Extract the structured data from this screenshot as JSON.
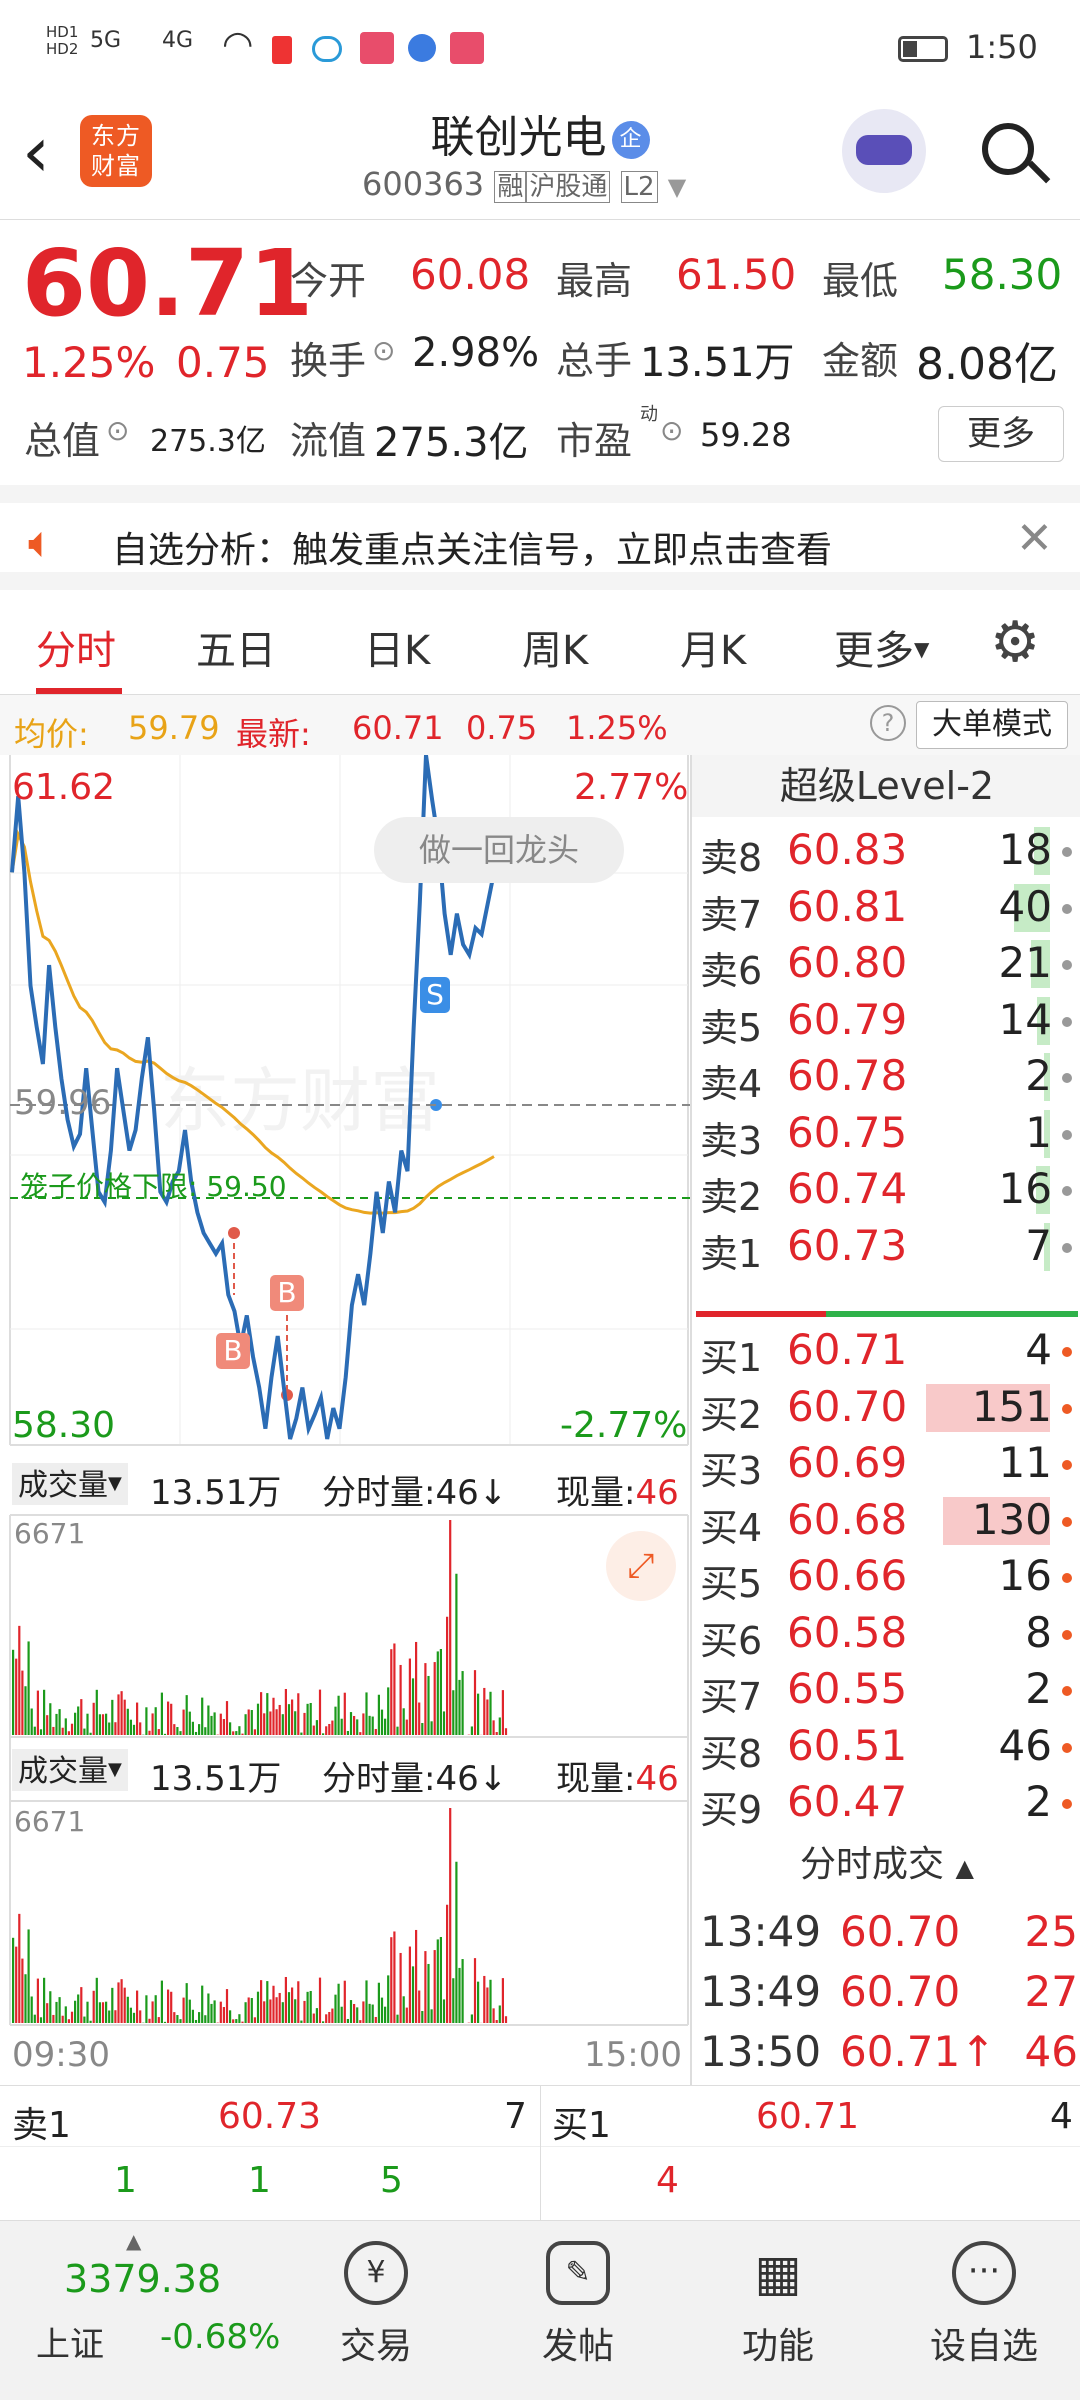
{
  "status": {
    "time": "1:50",
    "sig1": "5G",
    "sig2": "4G",
    "hd1": "HD1",
    "hd2": "HD2"
  },
  "header": {
    "logo": "东方财富",
    "title": "联创光电",
    "corp_badge": "企",
    "code": "600363",
    "tags": [
      "融",
      "沪股通",
      "L2"
    ]
  },
  "quote": {
    "price": "60.71",
    "pct": "1.25%",
    "chg": "0.75",
    "open_label": "今开",
    "open": "60.08",
    "high_label": "最高",
    "high": "61.50",
    "low_label": "最低",
    "low": "58.30",
    "turnover_label": "换手",
    "turnover": "2.98%",
    "vol_label": "总手",
    "vol": "13.51万",
    "amount_label": "金额",
    "amount": "8.08亿",
    "mktcap_label": "总值",
    "mktcap": "275.3亿",
    "float_label": "流值",
    "float": "275.3亿",
    "pe_label": "市盈",
    "pe_sup": "动",
    "pe": "59.28",
    "more": "更多"
  },
  "notice": {
    "text": "自选分析：触发重点关注信号，立即点击查看"
  },
  "tabs": [
    "分时",
    "五日",
    "日K",
    "周K",
    "月K",
    "更多"
  ],
  "infobar": {
    "avg_label": "均价:",
    "avg": "59.79",
    "last_label": "最新:",
    "last": "60.71",
    "chg": "0.75",
    "pct": "1.25%",
    "mode": "大单模式"
  },
  "chart": {
    "ymax": "61.62",
    "ymin": "58.30",
    "pct_up": "2.77%",
    "pct_down": "-2.77%",
    "prev_close": "59.96",
    "limit_label": "笼子价格下限:",
    "limit": "59.50",
    "bubble": "做一回龙头",
    "marker_s": "S",
    "marker_b": "B",
    "watermark": "东方财富",
    "vol_label": "成交量",
    "vol_total": "13.51万",
    "fs_label": "分时量:46↓",
    "now_label": "现量:",
    "now": "46",
    "vol_max": "6671",
    "t_start": "09:30",
    "t_end": "15:00",
    "price_path": [
      61.05,
      61.42,
      61.05,
      60.5,
      60.3,
      60.12,
      60.6,
      60.3,
      60.05,
      59.85,
      59.72,
      59.78,
      60.1,
      59.8,
      59.5,
      59.45,
      59.7,
      60.1,
      59.9,
      59.7,
      59.8,
      60.05,
      60.25,
      59.9,
      59.5,
      59.45,
      59.55,
      59.6,
      59.8,
      59.55,
      59.4,
      59.3,
      59.25,
      59.2,
      59.25,
      59.0,
      58.92,
      58.75,
      58.9,
      58.7,
      58.55,
      58.35,
      58.6,
      58.8,
      58.55,
      58.3,
      58.4,
      58.55,
      58.35,
      58.42,
      58.5,
      58.3,
      58.45,
      58.35,
      58.6,
      58.95,
      59.1,
      58.95,
      59.2,
      59.5,
      59.3,
      59.55,
      59.4,
      59.7,
      59.6,
      60.3,
      60.9,
      61.62,
      61.4,
      61.2,
      60.85,
      60.65,
      60.85,
      60.7,
      60.65,
      60.78,
      60.75,
      60.9,
      61.05
    ]
  },
  "panel": {
    "title": "超级Level-2",
    "asks": [
      {
        "label": "卖8",
        "price": "60.83",
        "qty": "18"
      },
      {
        "label": "卖7",
        "price": "60.81",
        "qty": "40"
      },
      {
        "label": "卖6",
        "price": "60.80",
        "qty": "21"
      },
      {
        "label": "卖5",
        "price": "60.79",
        "qty": "14"
      },
      {
        "label": "卖4",
        "price": "60.78",
        "qty": "2"
      },
      {
        "label": "卖3",
        "price": "60.75",
        "qty": "1"
      },
      {
        "label": "卖2",
        "price": "60.74",
        "qty": "16"
      },
      {
        "label": "卖1",
        "price": "60.73",
        "qty": "7"
      }
    ],
    "bids": [
      {
        "label": "买1",
        "price": "60.71",
        "qty": "4"
      },
      {
        "label": "买2",
        "price": "60.70",
        "qty": "151"
      },
      {
        "label": "买3",
        "price": "60.69",
        "qty": "11"
      },
      {
        "label": "买4",
        "price": "60.68",
        "qty": "130"
      },
      {
        "label": "买5",
        "price": "60.66",
        "qty": "16"
      },
      {
        "label": "买6",
        "price": "60.58",
        "qty": "8"
      },
      {
        "label": "买7",
        "price": "60.55",
        "qty": "2"
      },
      {
        "label": "买8",
        "price": "60.51",
        "qty": "46"
      },
      {
        "label": "买9",
        "price": "60.47",
        "qty": "2"
      }
    ],
    "trades_title": "分时成交",
    "trades": [
      {
        "time": "13:49",
        "price": "60.70",
        "qty": "25"
      },
      {
        "time": "13:49",
        "price": "60.70",
        "qty": "27"
      },
      {
        "time": "13:50",
        "price": "60.71↑",
        "qty": "46"
      }
    ]
  },
  "bottom": {
    "sell_label": "卖1",
    "sell_price": "60.73",
    "sell_qty": "7",
    "buy_label": "买1",
    "buy_price": "60.71",
    "buy_qty": "4",
    "queue": [
      "1",
      "1",
      "5"
    ],
    "buy_queue": [
      "4"
    ]
  },
  "nav": {
    "index": "3379.38",
    "index_name": "上证",
    "index_pct": "-0.68%",
    "items": [
      "交易",
      "发帖",
      "功能",
      "设自选"
    ]
  }
}
